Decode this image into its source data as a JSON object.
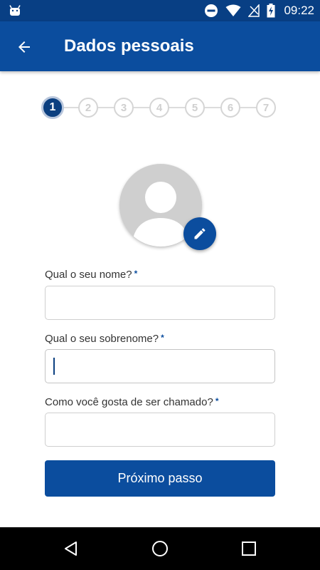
{
  "status_bar": {
    "time": "09:22",
    "icons": [
      "android-debug-icon",
      "do-not-disturb-icon",
      "wifi-icon",
      "no-signal-icon",
      "battery-charging-icon"
    ]
  },
  "app_bar": {
    "title": "Dados pessoais",
    "back_icon": "arrow-back-icon"
  },
  "stepper": {
    "steps": [
      "1",
      "2",
      "3",
      "4",
      "5",
      "6",
      "7"
    ],
    "current": 1
  },
  "avatar": {
    "edit_icon": "pencil-icon"
  },
  "form": {
    "first_name": {
      "label": "Qual o seu nome?",
      "required_mark": "*",
      "value": ""
    },
    "last_name": {
      "label": "Qual o seu sobrenome?",
      "required_mark": "*",
      "value": ""
    },
    "nickname": {
      "label": "Como você gosta de ser chamado?",
      "required_mark": "*",
      "value": ""
    },
    "submit_label": "Próximo passo"
  },
  "nav_bar": {
    "icons": [
      "back-triangle-icon",
      "home-circle-icon",
      "recents-square-icon"
    ]
  },
  "colors": {
    "status_bar": "#083f84",
    "primary": "#0b4d9e",
    "step_active": "#0b3f80",
    "step_inactive": "#d5d5d5"
  }
}
